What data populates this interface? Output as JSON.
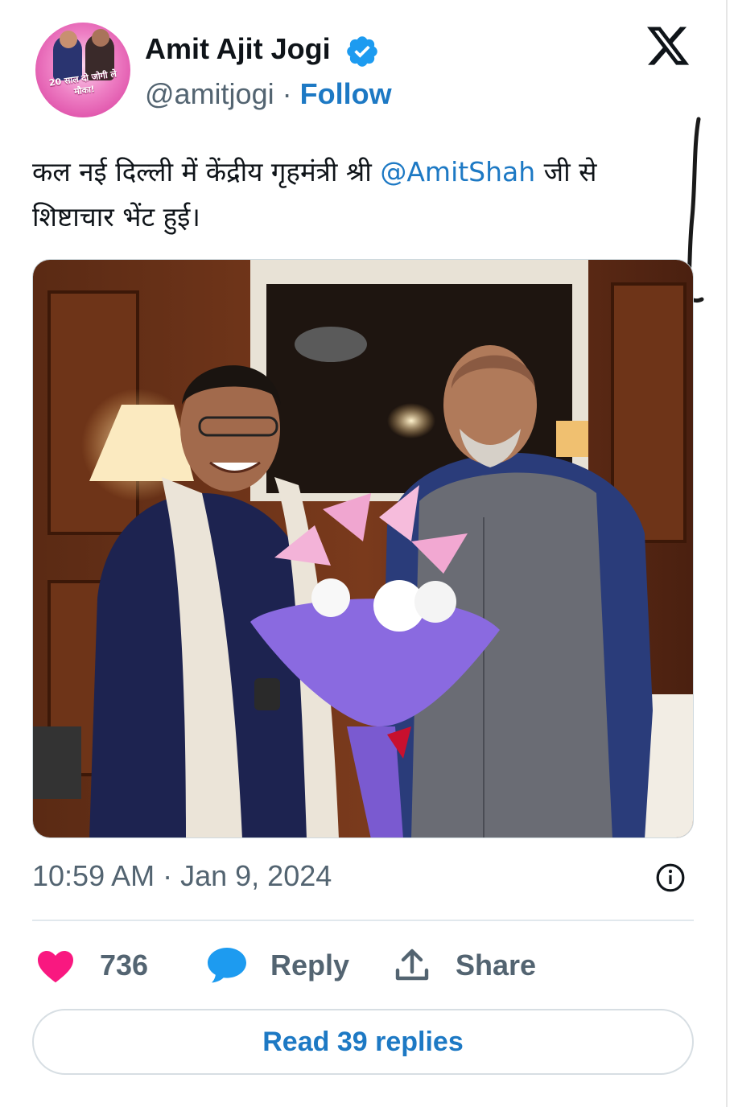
{
  "author": {
    "name": "Amit Ajit Jogi",
    "handle": "@amitjogi",
    "separator": " · ",
    "follow_label": "Follow",
    "avatar_caption": "20 साल दो जोगी ले मौका!"
  },
  "tweet": {
    "text_before": "कल नई दिल्ली में केंद्रीय गृहमंत्री श्री ",
    "mention": "@AmitShah",
    "text_after": " जी से शिष्टाचार भेंट हुई।",
    "timestamp": "10:59 AM · Jan 9, 2024"
  },
  "actions": {
    "likes": "736",
    "reply_label": "Reply",
    "share_label": "Share"
  },
  "read_replies_label": "Read 39 replies",
  "colors": {
    "accent": "#1d79c4",
    "like": "#f91880",
    "verified": "#1d9bf0",
    "muted": "#536471"
  },
  "icons": [
    "verified-badge-icon",
    "x-logo-icon",
    "info-icon",
    "heart-icon",
    "reply-bubble-icon",
    "share-icon"
  ]
}
